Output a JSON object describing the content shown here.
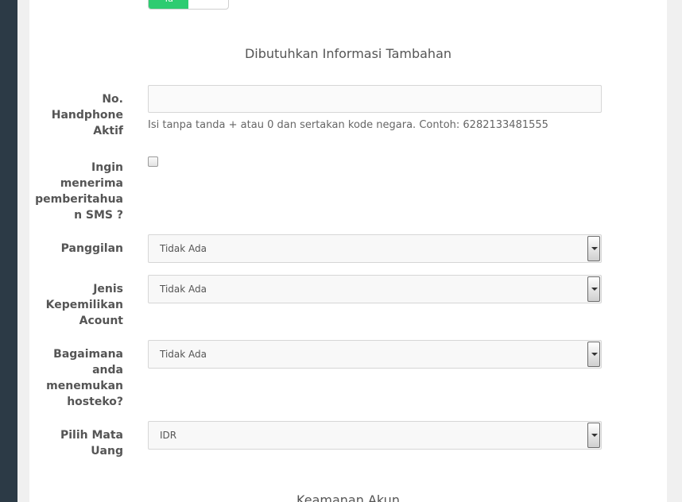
{
  "toggle": {
    "on_label": "Ya"
  },
  "section_title": "Dibutuhkan Informasi Tambahan",
  "phone": {
    "label": [
      "No.",
      "Handphone",
      "Aktif"
    ],
    "value": "",
    "placeholder": "",
    "help": "Isi tanpa tanda + atau 0 dan sertakan kode negara. Contoh: 6282133481555"
  },
  "sms": {
    "label": [
      "Ingin",
      "menerima",
      "pemberitahua",
      "n SMS ?"
    ],
    "checked": false
  },
  "panggilan": {
    "label": [
      "Panggilan"
    ],
    "selected": "Tidak Ada"
  },
  "jenis": {
    "label": [
      "Jenis",
      "Kepemilikan",
      "Acount"
    ],
    "selected": "Tidak Ada"
  },
  "bagaimana": {
    "label": [
      "Bagaimana",
      "anda",
      "menemukan",
      "hosteko?"
    ],
    "selected": "Tidak Ada"
  },
  "mata_uang": {
    "label": [
      "Pilih Mata",
      "Uang"
    ],
    "selected": "IDR"
  },
  "next_section_title": "Keamanan Akun"
}
